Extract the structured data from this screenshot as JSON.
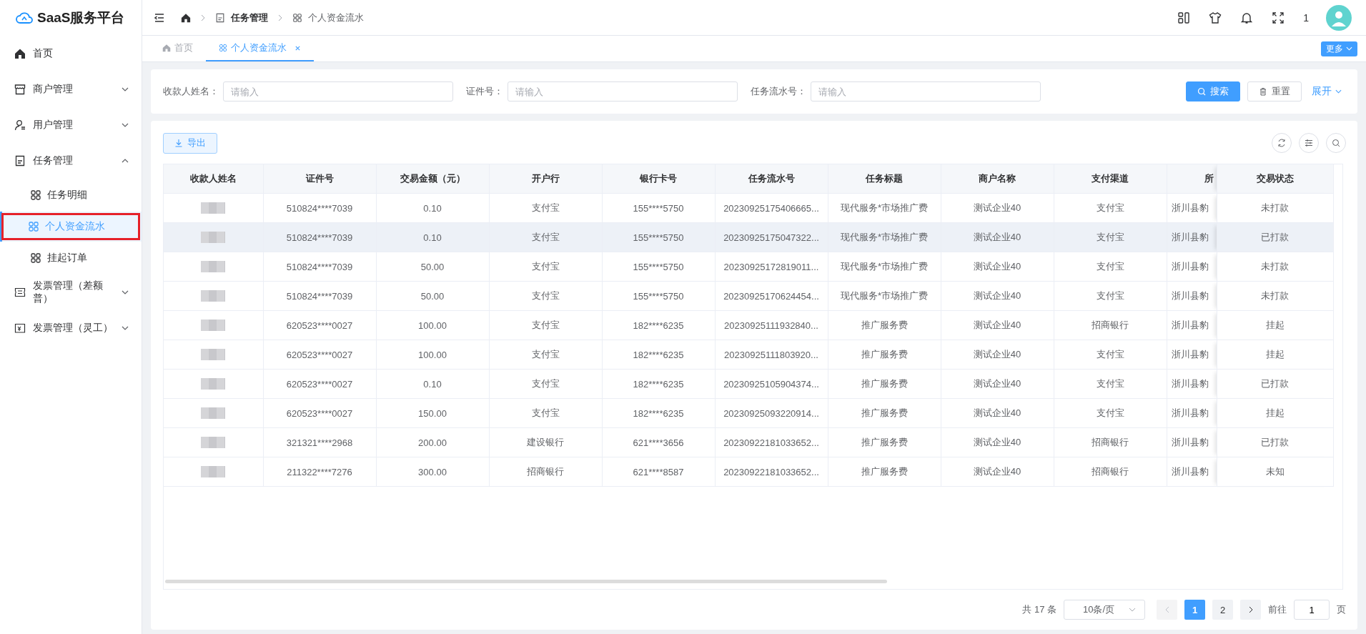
{
  "sidebar": {
    "logo": "SaaS服务平台",
    "items": [
      {
        "label": "首页"
      },
      {
        "label": "商户管理",
        "expanded": false
      },
      {
        "label": "用户管理",
        "expanded": false
      },
      {
        "label": "任务管理",
        "expanded": true,
        "children": [
          {
            "label": "任务明细",
            "selected": false,
            "highlighted": false
          },
          {
            "label": "个人资金流水",
            "selected": true,
            "highlighted": true
          },
          {
            "label": "挂起订单",
            "selected": false,
            "highlighted": false
          }
        ]
      },
      {
        "label": "发票管理（差额普）",
        "expanded": false
      },
      {
        "label": "发票管理（灵工）",
        "expanded": false
      }
    ]
  },
  "header": {
    "breadcrumb": [
      "任务管理",
      "个人资金流水"
    ],
    "user_count": "1"
  },
  "tabs": [
    {
      "label": "首页",
      "selected": false,
      "closable": false
    },
    {
      "label": "个人资金流水",
      "selected": true,
      "closable": true
    }
  ],
  "more_button": "更多",
  "filters": [
    {
      "label": "收款人姓名：",
      "placeholder": "请输入"
    },
    {
      "label": "证件号：",
      "placeholder": "请输入"
    },
    {
      "label": "任务流水号：",
      "placeholder": "请输入"
    }
  ],
  "filter_buttons": {
    "search": "搜索",
    "reset": "重置",
    "expand": "展开"
  },
  "export_button": "导出",
  "table": {
    "columns": [
      "收款人姓名",
      "证件号",
      "交易金额（元）",
      "开户行",
      "银行卡号",
      "任务流水号",
      "任务标题",
      "商户名称",
      "支付渠道",
      "所",
      "交易状态"
    ],
    "rows": [
      {
        "highlighted": false,
        "cells": [
          "",
          "510824****7039",
          "0.10",
          "支付宝",
          "155****5750",
          "20230925175406665...",
          "现代服务*市场推广费",
          "测试企业40",
          "支付宝",
          "浙川县豹",
          "未打款"
        ]
      },
      {
        "highlighted": true,
        "cells": [
          "",
          "510824****7039",
          "0.10",
          "支付宝",
          "155****5750",
          "20230925175047322...",
          "现代服务*市场推广费",
          "测试企业40",
          "支付宝",
          "浙川县豹",
          "已打款"
        ]
      },
      {
        "highlighted": false,
        "cells": [
          "",
          "510824****7039",
          "50.00",
          "支付宝",
          "155****5750",
          "20230925172819011...",
          "现代服务*市场推广费",
          "测试企业40",
          "支付宝",
          "浙川县豹",
          "未打款"
        ]
      },
      {
        "highlighted": false,
        "cells": [
          "",
          "510824****7039",
          "50.00",
          "支付宝",
          "155****5750",
          "20230925170624454...",
          "现代服务*市场推广费",
          "测试企业40",
          "支付宝",
          "浙川县豹",
          "未打款"
        ]
      },
      {
        "highlighted": false,
        "cells": [
          "",
          "620523****0027",
          "100.00",
          "支付宝",
          "182****6235",
          "20230925111932840...",
          "推广服务费",
          "测试企业40",
          "招商银行",
          "浙川县豹",
          "挂起"
        ]
      },
      {
        "highlighted": false,
        "cells": [
          "",
          "620523****0027",
          "100.00",
          "支付宝",
          "182****6235",
          "20230925111803920...",
          "推广服务费",
          "测试企业40",
          "支付宝",
          "浙川县豹",
          "挂起"
        ]
      },
      {
        "highlighted": false,
        "cells": [
          "",
          "620523****0027",
          "0.10",
          "支付宝",
          "182****6235",
          "20230925105904374...",
          "推广服务费",
          "测试企业40",
          "支付宝",
          "浙川县豹",
          "已打款"
        ]
      },
      {
        "highlighted": false,
        "cells": [
          "",
          "620523****0027",
          "150.00",
          "支付宝",
          "182****6235",
          "20230925093220914...",
          "推广服务费",
          "测试企业40",
          "支付宝",
          "浙川县豹",
          "挂起"
        ]
      },
      {
        "highlighted": false,
        "cells": [
          "",
          "321321****2968",
          "200.00",
          "建设银行",
          "621****3656",
          "20230922181033652...",
          "推广服务费",
          "测试企业40",
          "招商银行",
          "浙川县豹",
          "已打款"
        ]
      },
      {
        "highlighted": false,
        "cells": [
          "",
          "211322****7276",
          "300.00",
          "招商银行",
          "621****8587",
          "20230922181033652...",
          "推广服务费",
          "测试企业40",
          "招商银行",
          "浙川县豹",
          "未知"
        ]
      }
    ]
  },
  "pagination": {
    "total": "共 17 条",
    "page_size": "10条/页",
    "pages": [
      {
        "label": "1",
        "selected": true
      },
      {
        "label": "2",
        "selected": false
      }
    ],
    "goto_label": "前往",
    "goto_value": "1",
    "goto_suffix": "页"
  }
}
